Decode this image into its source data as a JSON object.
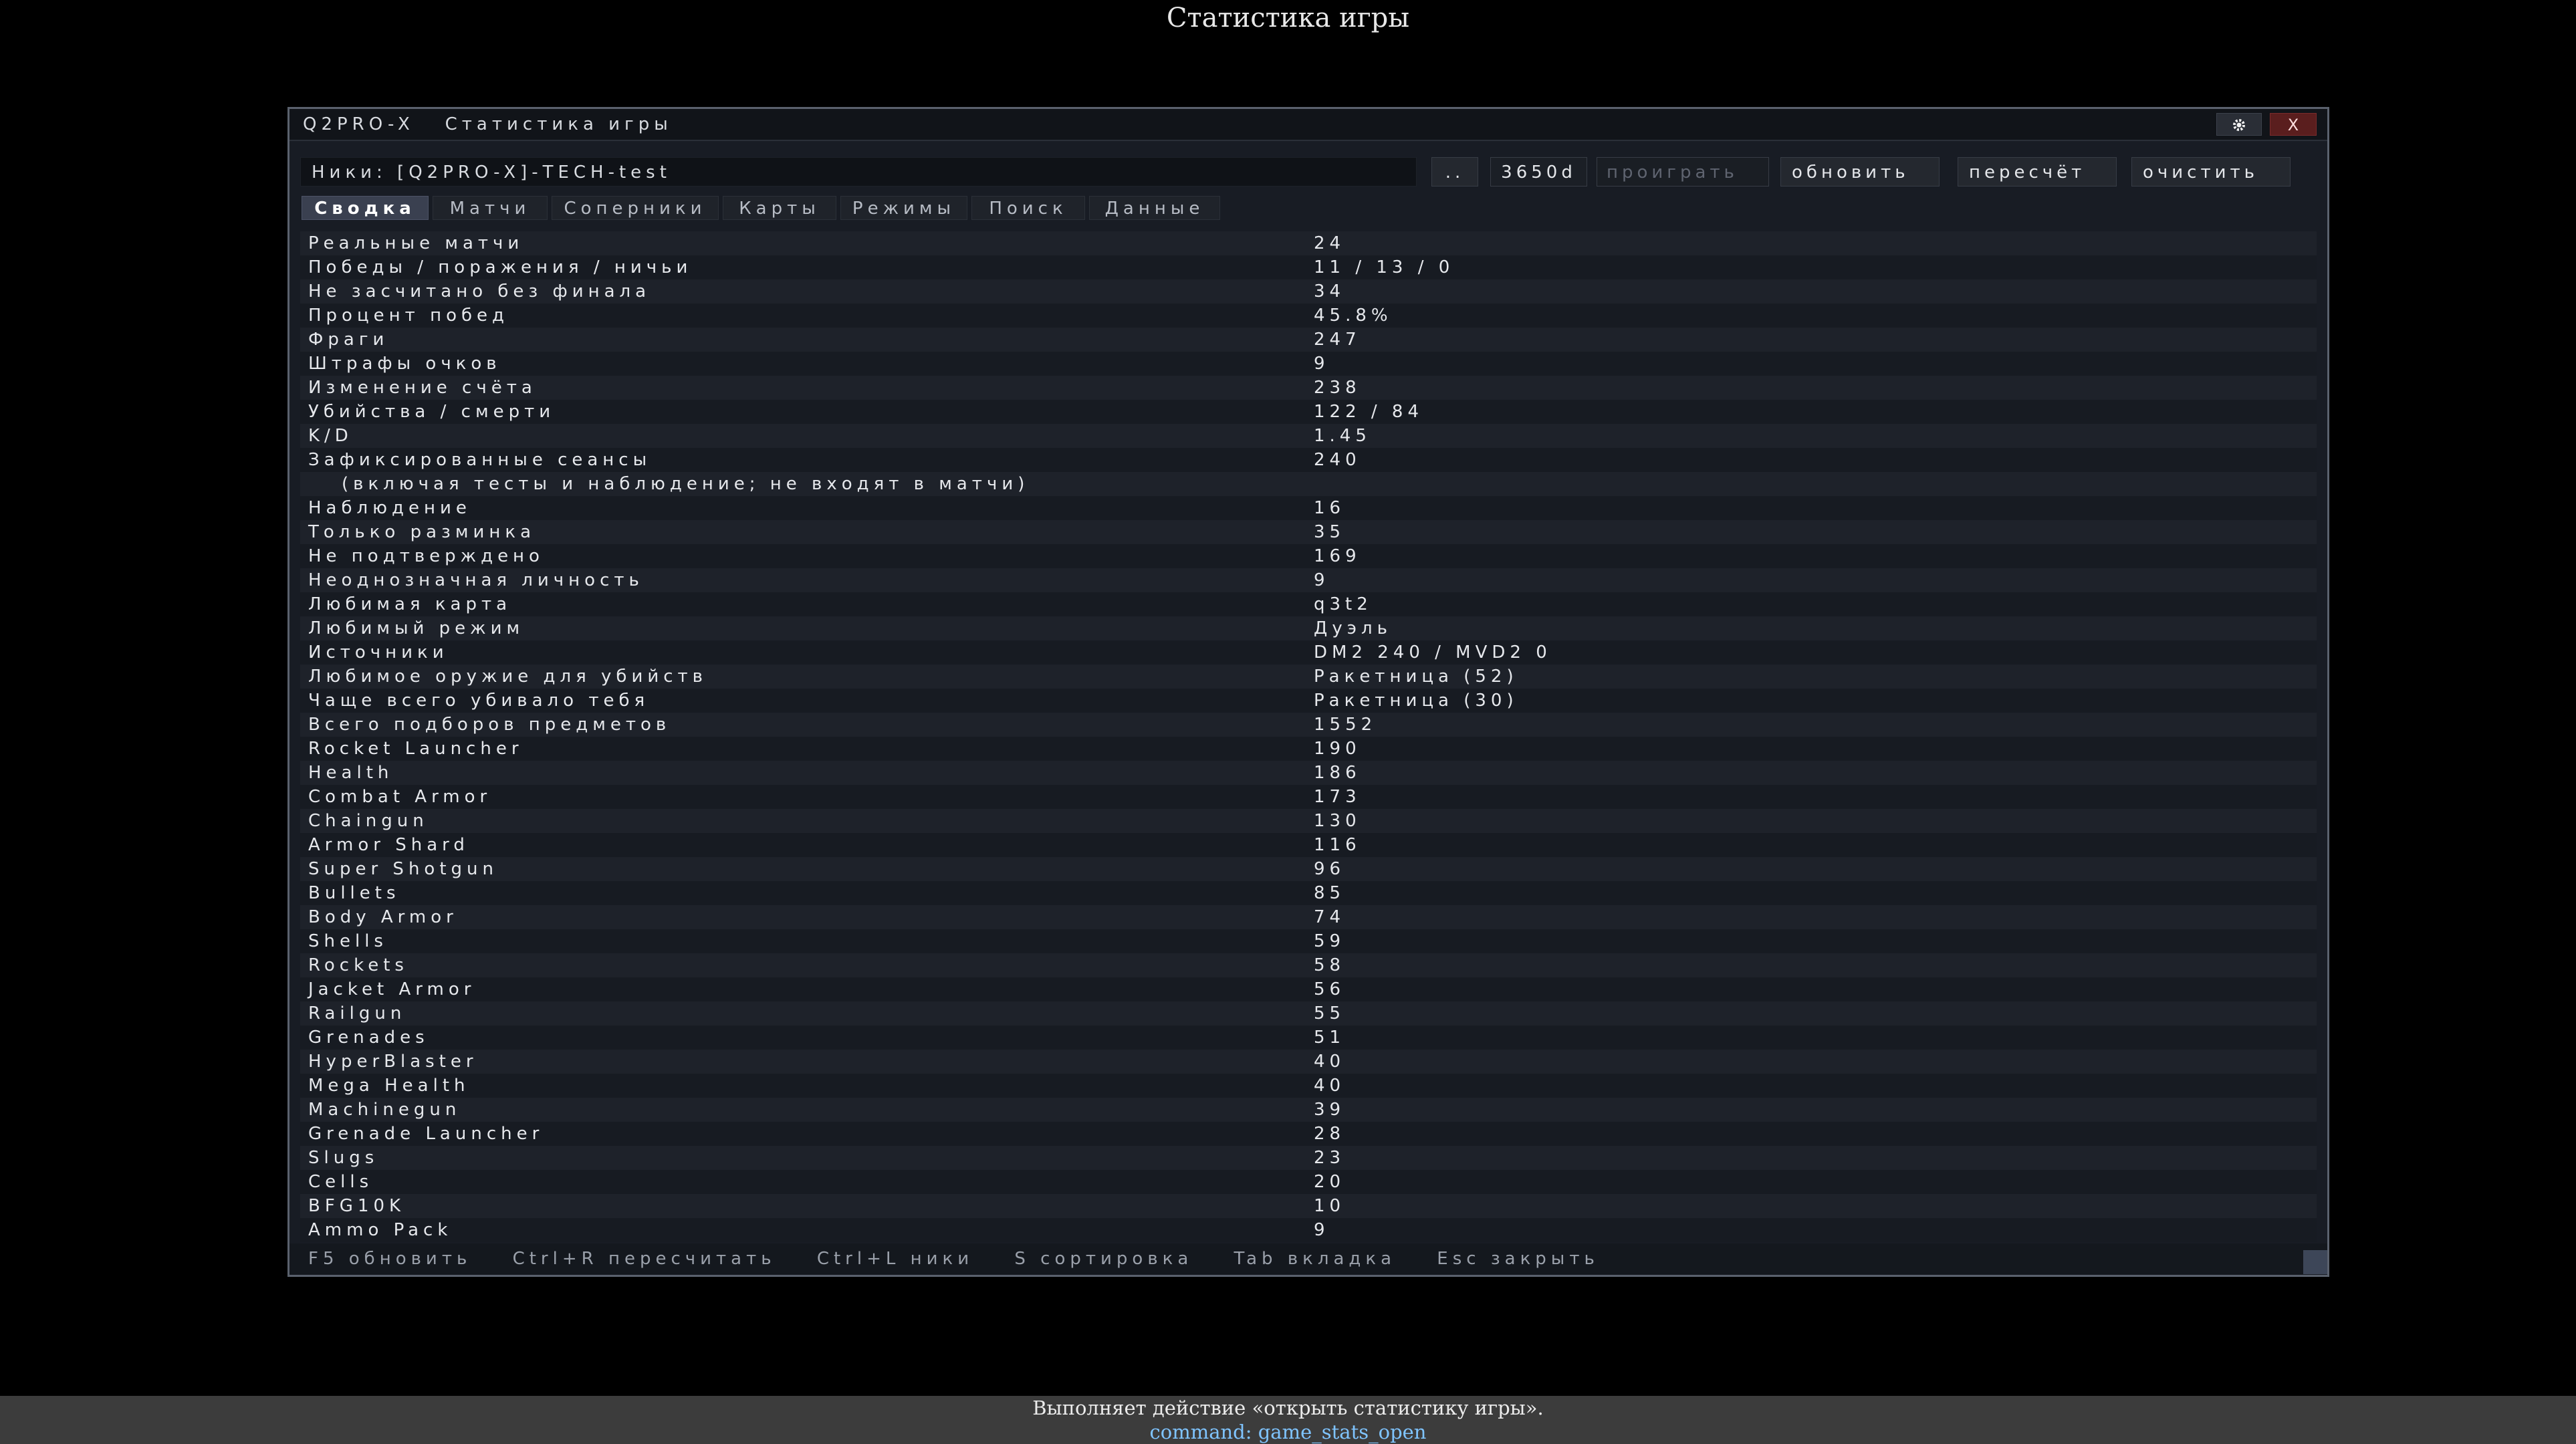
{
  "page_title": "Статистика игры",
  "window": {
    "app_title": "Q2PRO-X   Статистика игры",
    "settings_icon": "gear-icon",
    "close_label": "X"
  },
  "toolbar": {
    "nick_field_value": "Ники: [Q2PRO-X]-TECH-test",
    "dots_label": "..",
    "days_value": "3650d",
    "replay_label": "проиграть",
    "refresh_label": "обновить",
    "recalc_label": "пересчёт",
    "clear_label": "очистить"
  },
  "tabs": [
    "Сводка",
    "Матчи",
    "Соперники",
    "Карты",
    "Режимы",
    "Поиск",
    "Данные"
  ],
  "active_tab": "Сводка",
  "stats": [
    {
      "label": "Реальные матчи",
      "value": "24"
    },
    {
      "label": "Победы / поражения / ничьи",
      "value": "11 / 13 / 0"
    },
    {
      "label": "Не засчитано без финала",
      "value": "34"
    },
    {
      "label": "Процент побед",
      "value": "45.8%"
    },
    {
      "label": "Фраги",
      "value": "247"
    },
    {
      "label": "Штрафы очков",
      "value": "9"
    },
    {
      "label": "Изменение счёта",
      "value": "238"
    },
    {
      "label": "Убийства / смерти",
      "value": "122 / 84"
    },
    {
      "label": "K/D",
      "value": "1.45"
    },
    {
      "label": "Зафиксированные сеансы",
      "value": "240"
    },
    {
      "label": "(включая тесты и наблюдение; не входят в матчи)",
      "value": "",
      "sub": true
    },
    {
      "label": "Наблюдение",
      "value": "16"
    },
    {
      "label": "Только разминка",
      "value": "35"
    },
    {
      "label": "Не подтверждено",
      "value": "169"
    },
    {
      "label": "Неоднозначная личность",
      "value": "9"
    },
    {
      "label": "Любимая карта",
      "value": "q3t2"
    },
    {
      "label": "Любимый режим",
      "value": "Дуэль"
    },
    {
      "label": "Источники",
      "value": "DM2 240 / MVD2 0"
    },
    {
      "label": "Любимое оружие для убийств",
      "value": "Ракетница (52)"
    },
    {
      "label": "Чаще всего убивало тебя",
      "value": "Ракетница (30)"
    },
    {
      "label": "Всего подборов предметов",
      "value": "1552"
    },
    {
      "label": "Rocket Launcher",
      "value": "190"
    },
    {
      "label": "Health",
      "value": "186"
    },
    {
      "label": "Combat Armor",
      "value": "173"
    },
    {
      "label": "Chaingun",
      "value": "130"
    },
    {
      "label": "Armor Shard",
      "value": "116"
    },
    {
      "label": "Super Shotgun",
      "value": "96"
    },
    {
      "label": "Bullets",
      "value": "85"
    },
    {
      "label": "Body Armor",
      "value": "74"
    },
    {
      "label": "Shells",
      "value": "59"
    },
    {
      "label": "Rockets",
      "value": "58"
    },
    {
      "label": "Jacket Armor",
      "value": "56"
    },
    {
      "label": "Railgun",
      "value": "55"
    },
    {
      "label": "Grenades",
      "value": "51"
    },
    {
      "label": "HyperBlaster",
      "value": "40"
    },
    {
      "label": "Mega Health",
      "value": "40"
    },
    {
      "label": "Machinegun",
      "value": "39"
    },
    {
      "label": "Grenade Launcher",
      "value": "28"
    },
    {
      "label": "Slugs",
      "value": "23"
    },
    {
      "label": "Cells",
      "value": "20"
    },
    {
      "label": "BFG10K",
      "value": "10"
    },
    {
      "label": "Ammo Pack",
      "value": "9"
    }
  ],
  "hotkeys": [
    "F5 обновить",
    "Ctrl+R пересчитать",
    "Ctrl+L ники",
    "S сортировка",
    "Tab вкладка",
    "Esc закрыть"
  ],
  "status": {
    "text": "Выполняет действие «открыть статистику игры».",
    "command": "command: game_stats_open"
  },
  "colors": {
    "background": "#000000",
    "window_bg": "#181c24",
    "active_tab": "#3a4050",
    "close_button": "#5a1e1e",
    "command_text": "#7fc4ff"
  }
}
